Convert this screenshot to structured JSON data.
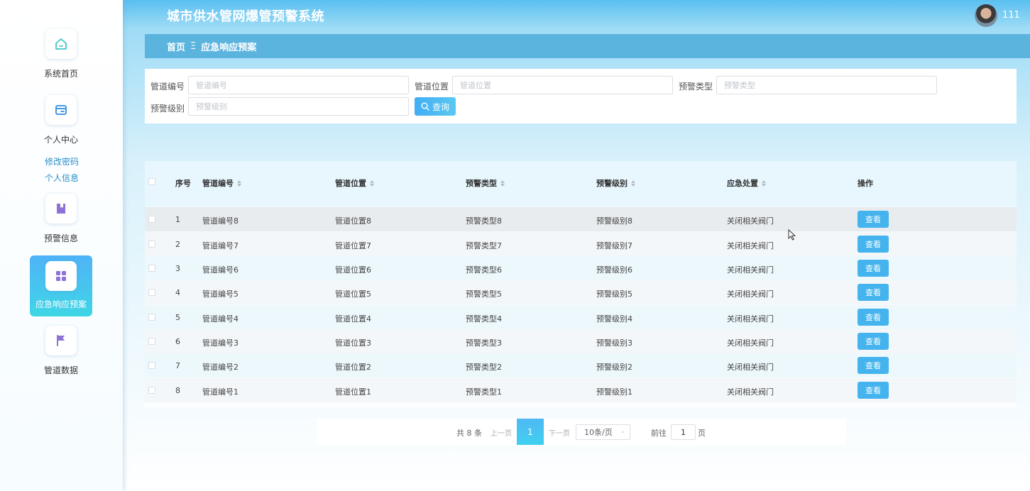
{
  "app": {
    "title": "城市供水管网爆管预警系统",
    "user_name": "111"
  },
  "sidebar": {
    "items": [
      {
        "label": "系统首页",
        "icon": "home-icon"
      },
      {
        "label": "个人中心",
        "icon": "card-icon"
      },
      {
        "label": "预警信息",
        "icon": "book-icon"
      },
      {
        "label": "应急响应预案",
        "icon": "grid-icon",
        "active": true
      },
      {
        "label": "管道数据",
        "icon": "flag-icon"
      }
    ],
    "sub_links": [
      "修改密码",
      "个人信息"
    ]
  },
  "breadcrumb": {
    "home": "首页",
    "separator": "Ξ",
    "current": "应急响应预案"
  },
  "search": {
    "fields": [
      {
        "label": "管道编号",
        "placeholder": "管道编号"
      },
      {
        "label": "管道位置",
        "placeholder": "管道位置"
      },
      {
        "label": "预警类型",
        "placeholder": "预警类型"
      },
      {
        "label": "预警级别",
        "placeholder": "预警级别"
      }
    ],
    "button_label": "查询"
  },
  "table": {
    "columns": [
      "序号",
      "管道编号",
      "管道位置",
      "预警类型",
      "预警级别",
      "应急处置",
      "操作"
    ],
    "rows": [
      {
        "index": "1",
        "pipe_no": "管道编号8",
        "pipe_loc": "管道位置8",
        "alert_type": "预警类型8",
        "alert_level": "预警级别8",
        "action": "关闭相关阀门"
      },
      {
        "index": "2",
        "pipe_no": "管道编号7",
        "pipe_loc": "管道位置7",
        "alert_type": "预警类型7",
        "alert_level": "预警级别7",
        "action": "关闭相关阀门"
      },
      {
        "index": "3",
        "pipe_no": "管道编号6",
        "pipe_loc": "管道位置6",
        "alert_type": "预警类型6",
        "alert_level": "预警级别6",
        "action": "关闭相关阀门"
      },
      {
        "index": "4",
        "pipe_no": "管道编号5",
        "pipe_loc": "管道位置5",
        "alert_type": "预警类型5",
        "alert_level": "预警级别5",
        "action": "关闭相关阀门"
      },
      {
        "index": "5",
        "pipe_no": "管道编号4",
        "pipe_loc": "管道位置4",
        "alert_type": "预警类型4",
        "alert_level": "预警级别4",
        "action": "关闭相关阀门"
      },
      {
        "index": "6",
        "pipe_no": "管道编号3",
        "pipe_loc": "管道位置3",
        "alert_type": "预警类型3",
        "alert_level": "预警级别3",
        "action": "关闭相关阀门"
      },
      {
        "index": "7",
        "pipe_no": "管道编号2",
        "pipe_loc": "管道位置2",
        "alert_type": "预警类型2",
        "alert_level": "预警级别2",
        "action": "关闭相关阀门"
      },
      {
        "index": "8",
        "pipe_no": "管道编号1",
        "pipe_loc": "管道位置1",
        "alert_type": "预警类型1",
        "alert_level": "预警级别1",
        "action": "关闭相关阀门"
      }
    ],
    "view_label": "查看"
  },
  "pagination": {
    "total": "共 8 条",
    "prev": "上一页",
    "current": "1",
    "next": "下一页",
    "page_size": "10条/页",
    "goto_label": "前往",
    "goto_value": "1",
    "page_unit": "页"
  },
  "colors": {
    "accent": "#45b4ee",
    "breadcrumb": "#5bb4de",
    "sidebar_active": "#4fb3f7"
  }
}
